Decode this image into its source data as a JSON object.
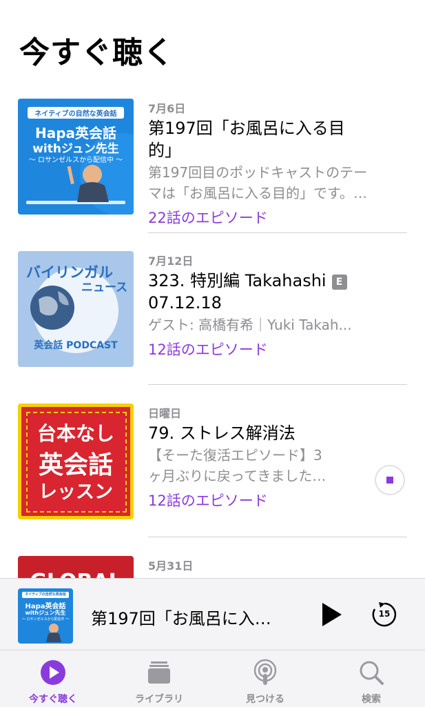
{
  "header": {
    "title": "今すぐ聴く"
  },
  "episodes": [
    {
      "date": "7月6日",
      "title": "第197回「お風呂に入る目的」",
      "desc_line1": "第197回目のポッドキャストのテー",
      "desc_line2": "マは「お風呂に入る目的」です。…",
      "episodes_label": "22話のエピソード",
      "art": {
        "top_banner": "ネイティブの自然な英会話",
        "line1": "Hapa英会話",
        "line2": "withジュン先生",
        "sub": "〜 ロサンゼルスから配信中 〜",
        "bg": "#1e7fd6"
      }
    },
    {
      "date": "7月12日",
      "title_line1": "323. 特別編 Takahashi",
      "title_line2": "07.12.18",
      "explicit": "E",
      "desc_line1": "ゲスト: 高橋有希｜Yuki Takah...",
      "episodes_label": "12話のエピソード",
      "art": {
        "line1": "バイリンガル",
        "line2": "ニュース",
        "bottom": "英会話 PODCAST",
        "bg": "#9dbde4"
      }
    },
    {
      "date": "日曜日",
      "title": "79. ストレス解消法",
      "desc_line1": "【そーた復活エピソード】3",
      "desc_line2": "ヶ月ぶりに戻ってきました…",
      "episodes_label": "12話のエピソード",
      "art": {
        "line1": "台本なし",
        "line2": "英会話",
        "line3": "レッスン",
        "bg": "#d8252f",
        "border": "#f5d000"
      }
    },
    {
      "date": "5月31日",
      "art": {
        "text": "GLOBAL",
        "bg": "#c8202b"
      }
    }
  ],
  "mini_player": {
    "title": "第197回「お風呂に入…",
    "skip_seconds": "15",
    "art": {
      "top_banner": "ネイティブの自然な英会話",
      "line1": "Hapa英会話",
      "line2": "withジュン先生",
      "sub": "〜 ロサンゼルスから配信中 〜"
    }
  },
  "tabs": [
    {
      "label": "今すぐ聴く",
      "icon": "play-circle-icon",
      "active": true
    },
    {
      "label": "ライブラリ",
      "icon": "library-icon",
      "active": false
    },
    {
      "label": "見つける",
      "icon": "podcast-icon",
      "active": false
    },
    {
      "label": "検索",
      "icon": "search-icon",
      "active": false
    }
  ],
  "colors": {
    "accent": "#8a3bdd",
    "secondary_text": "#8e8e93"
  }
}
